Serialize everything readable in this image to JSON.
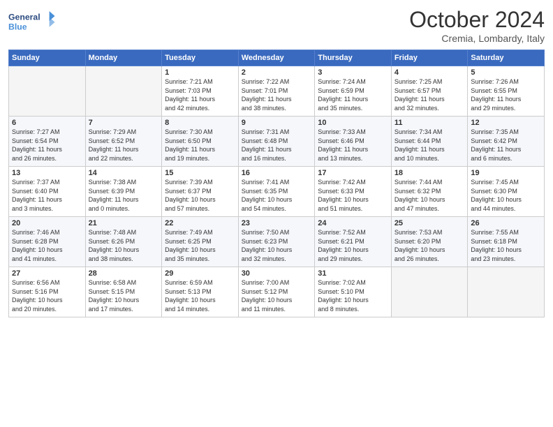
{
  "header": {
    "logo_line1": "General",
    "logo_line2": "Blue",
    "month": "October 2024",
    "location": "Cremia, Lombardy, Italy"
  },
  "days_of_week": [
    "Sunday",
    "Monday",
    "Tuesday",
    "Wednesday",
    "Thursday",
    "Friday",
    "Saturday"
  ],
  "weeks": [
    [
      {
        "day": "",
        "info": ""
      },
      {
        "day": "",
        "info": ""
      },
      {
        "day": "1",
        "info": "Sunrise: 7:21 AM\nSunset: 7:03 PM\nDaylight: 11 hours\nand 42 minutes."
      },
      {
        "day": "2",
        "info": "Sunrise: 7:22 AM\nSunset: 7:01 PM\nDaylight: 11 hours\nand 38 minutes."
      },
      {
        "day": "3",
        "info": "Sunrise: 7:24 AM\nSunset: 6:59 PM\nDaylight: 11 hours\nand 35 minutes."
      },
      {
        "day": "4",
        "info": "Sunrise: 7:25 AM\nSunset: 6:57 PM\nDaylight: 11 hours\nand 32 minutes."
      },
      {
        "day": "5",
        "info": "Sunrise: 7:26 AM\nSunset: 6:55 PM\nDaylight: 11 hours\nand 29 minutes."
      }
    ],
    [
      {
        "day": "6",
        "info": "Sunrise: 7:27 AM\nSunset: 6:54 PM\nDaylight: 11 hours\nand 26 minutes."
      },
      {
        "day": "7",
        "info": "Sunrise: 7:29 AM\nSunset: 6:52 PM\nDaylight: 11 hours\nand 22 minutes."
      },
      {
        "day": "8",
        "info": "Sunrise: 7:30 AM\nSunset: 6:50 PM\nDaylight: 11 hours\nand 19 minutes."
      },
      {
        "day": "9",
        "info": "Sunrise: 7:31 AM\nSunset: 6:48 PM\nDaylight: 11 hours\nand 16 minutes."
      },
      {
        "day": "10",
        "info": "Sunrise: 7:33 AM\nSunset: 6:46 PM\nDaylight: 11 hours\nand 13 minutes."
      },
      {
        "day": "11",
        "info": "Sunrise: 7:34 AM\nSunset: 6:44 PM\nDaylight: 11 hours\nand 10 minutes."
      },
      {
        "day": "12",
        "info": "Sunrise: 7:35 AM\nSunset: 6:42 PM\nDaylight: 11 hours\nand 6 minutes."
      }
    ],
    [
      {
        "day": "13",
        "info": "Sunrise: 7:37 AM\nSunset: 6:40 PM\nDaylight: 11 hours\nand 3 minutes."
      },
      {
        "day": "14",
        "info": "Sunrise: 7:38 AM\nSunset: 6:39 PM\nDaylight: 11 hours\nand 0 minutes."
      },
      {
        "day": "15",
        "info": "Sunrise: 7:39 AM\nSunset: 6:37 PM\nDaylight: 10 hours\nand 57 minutes."
      },
      {
        "day": "16",
        "info": "Sunrise: 7:41 AM\nSunset: 6:35 PM\nDaylight: 10 hours\nand 54 minutes."
      },
      {
        "day": "17",
        "info": "Sunrise: 7:42 AM\nSunset: 6:33 PM\nDaylight: 10 hours\nand 51 minutes."
      },
      {
        "day": "18",
        "info": "Sunrise: 7:44 AM\nSunset: 6:32 PM\nDaylight: 10 hours\nand 47 minutes."
      },
      {
        "day": "19",
        "info": "Sunrise: 7:45 AM\nSunset: 6:30 PM\nDaylight: 10 hours\nand 44 minutes."
      }
    ],
    [
      {
        "day": "20",
        "info": "Sunrise: 7:46 AM\nSunset: 6:28 PM\nDaylight: 10 hours\nand 41 minutes."
      },
      {
        "day": "21",
        "info": "Sunrise: 7:48 AM\nSunset: 6:26 PM\nDaylight: 10 hours\nand 38 minutes."
      },
      {
        "day": "22",
        "info": "Sunrise: 7:49 AM\nSunset: 6:25 PM\nDaylight: 10 hours\nand 35 minutes."
      },
      {
        "day": "23",
        "info": "Sunrise: 7:50 AM\nSunset: 6:23 PM\nDaylight: 10 hours\nand 32 minutes."
      },
      {
        "day": "24",
        "info": "Sunrise: 7:52 AM\nSunset: 6:21 PM\nDaylight: 10 hours\nand 29 minutes."
      },
      {
        "day": "25",
        "info": "Sunrise: 7:53 AM\nSunset: 6:20 PM\nDaylight: 10 hours\nand 26 minutes."
      },
      {
        "day": "26",
        "info": "Sunrise: 7:55 AM\nSunset: 6:18 PM\nDaylight: 10 hours\nand 23 minutes."
      }
    ],
    [
      {
        "day": "27",
        "info": "Sunrise: 6:56 AM\nSunset: 5:16 PM\nDaylight: 10 hours\nand 20 minutes."
      },
      {
        "day": "28",
        "info": "Sunrise: 6:58 AM\nSunset: 5:15 PM\nDaylight: 10 hours\nand 17 minutes."
      },
      {
        "day": "29",
        "info": "Sunrise: 6:59 AM\nSunset: 5:13 PM\nDaylight: 10 hours\nand 14 minutes."
      },
      {
        "day": "30",
        "info": "Sunrise: 7:00 AM\nSunset: 5:12 PM\nDaylight: 10 hours\nand 11 minutes."
      },
      {
        "day": "31",
        "info": "Sunrise: 7:02 AM\nSunset: 5:10 PM\nDaylight: 10 hours\nand 8 minutes."
      },
      {
        "day": "",
        "info": ""
      },
      {
        "day": "",
        "info": ""
      }
    ]
  ]
}
